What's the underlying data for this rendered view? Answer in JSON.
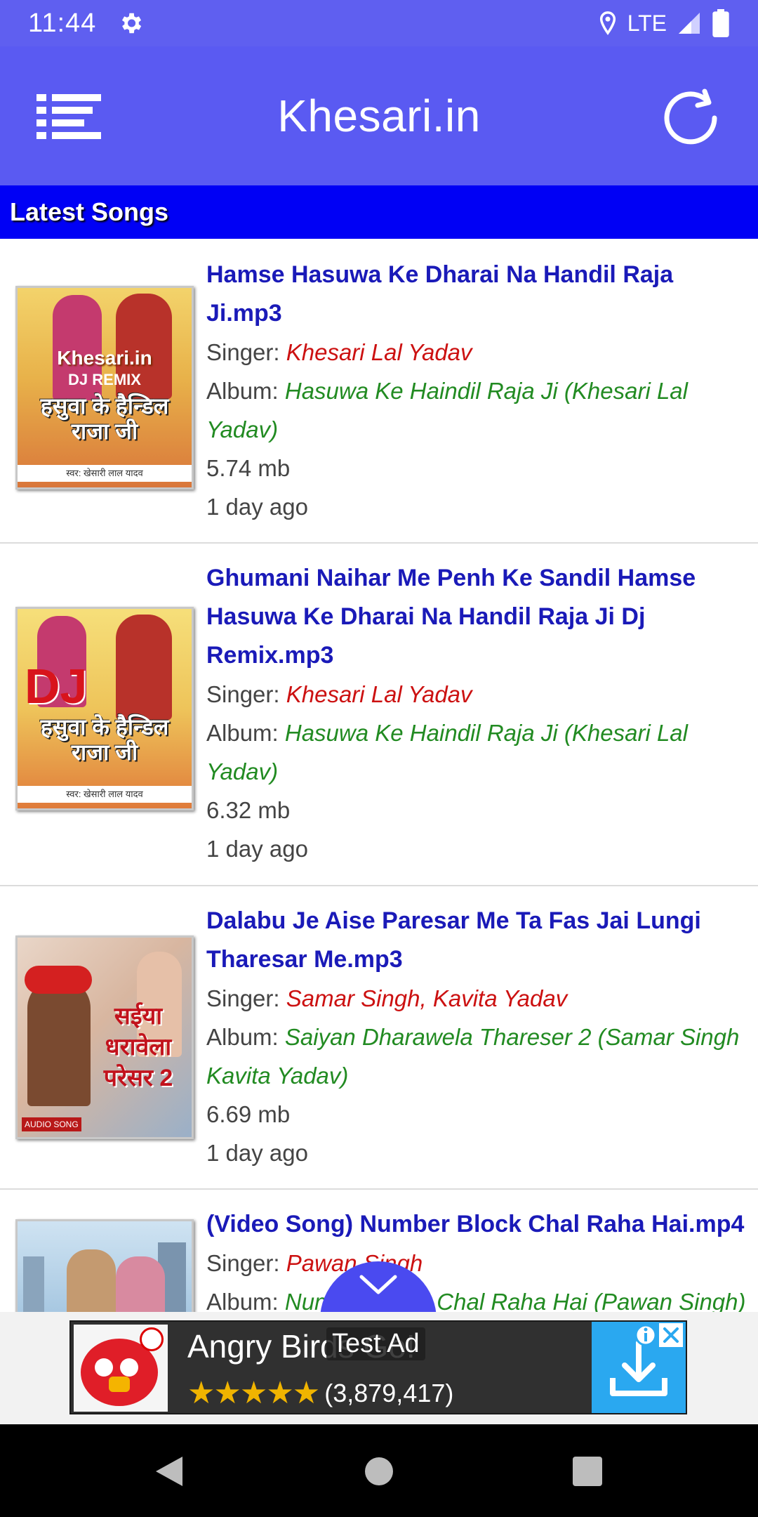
{
  "status_bar": {
    "time": "11:44",
    "network": "LTE"
  },
  "app_bar": {
    "title": "Khesari.in"
  },
  "section": {
    "title": "Latest Songs"
  },
  "labels": {
    "singer": "Singer: ",
    "album": "Album: "
  },
  "songs": [
    {
      "title": "Hamse Hasuwa Ke Dharai Na Handil Raja Ji.mp3",
      "singer": "Khesari Lal Yadav",
      "album": "Hasuwa Ke Haindil Raja Ji (Khesari Lal Yadav)",
      "size": "5.74 mb",
      "age": "1 day ago",
      "thumb_text_top": "Khesari.in",
      "thumb_text_sub": "DJ REMIX",
      "thumb_text_main": "हसुवा के हैन्डिल राजा जी",
      "thumb_text_credit": "स्वर: खेसारी लाल यादव"
    },
    {
      "title": "Ghumani Naihar Me Penh Ke Sandil Hamse Hasuwa Ke Dharai Na Handil Raja Ji Dj Remix.mp3",
      "singer": "Khesari Lal Yadav",
      "album": "Hasuwa Ke Haindil Raja Ji (Khesari Lal Yadav)",
      "size": "6.32 mb",
      "age": "1 day ago",
      "thumb_text_top": "DJ",
      "thumb_text_main": "हसुवा के हैन्डिल राजा जी",
      "thumb_text_credit": "स्वर: खेसारी लाल यादव"
    },
    {
      "title": "Dalabu Je Aise Paresar Me Ta Fas Jai Lungi Tharesar Me.mp3",
      "singer": "Samar Singh, Kavita Yadav",
      "album": "Saiyan Dharawela Thareser 2 (Samar Singh Kavita Yadav)",
      "size": "6.69 mb",
      "age": "1 day ago",
      "thumb_text_main": "सईया धरावेला परेसर 2",
      "thumb_text_credit": "AUDIO SONG"
    },
    {
      "title": "(Video Song) Number Block Chal Raha Hai.mp4",
      "singer": "Pawan Singh",
      "album": "Number Block Chal Raha Hai (Pawan Singh)",
      "size": "",
      "age": ""
    }
  ],
  "ad": {
    "app_name": "Angry Birds Go!",
    "stars": "★★★★★",
    "rating_count": "(3,879,417)",
    "test_label": "Test Ad"
  },
  "colors": {
    "status_bar": "#5f5ff0",
    "app_bar": "#5a5af2",
    "section_header": "#0000f5",
    "song_title": "#1a1ab8",
    "singer": "#cc1111",
    "album": "#228b22"
  }
}
